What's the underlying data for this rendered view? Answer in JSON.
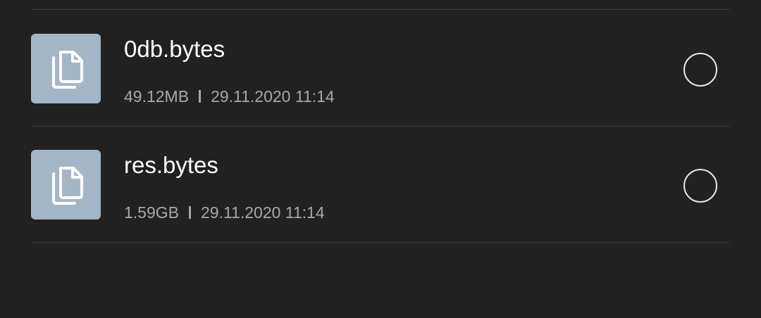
{
  "files": [
    {
      "name": "0db.bytes",
      "size": "49.12MB",
      "modified": "29.11.2020 11:14",
      "icon": "copy-files-icon"
    },
    {
      "name": "res.bytes",
      "size": "1.59GB",
      "modified": "29.11.2020 11:14",
      "icon": "copy-files-icon"
    }
  ],
  "colors": {
    "background": "#212121",
    "thumbnail": "#a3b6c8",
    "primary_text": "#ffffff",
    "secondary_text": "#a8a8a8",
    "divider": "#3a3a3a"
  }
}
